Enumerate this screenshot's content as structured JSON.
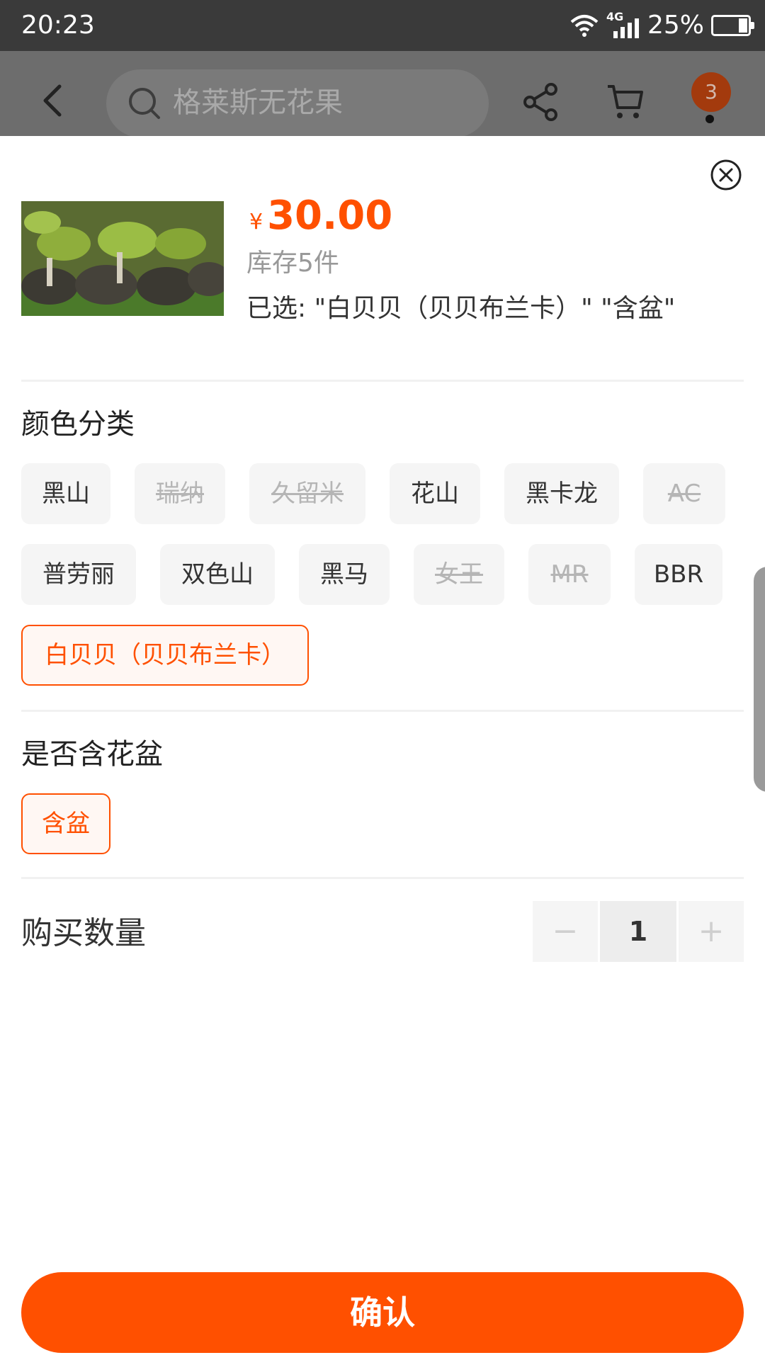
{
  "status_bar": {
    "time": "20:23",
    "network": "4G",
    "battery": "25%",
    "battery_level": 0.25
  },
  "header": {
    "back_icon": "chevron-left-icon",
    "search_placeholder": "格莱斯无花果",
    "share_icon": "share-icon",
    "cart_icon": "cart-icon",
    "badge_count": "3"
  },
  "product": {
    "currency": "¥",
    "price": "30.00",
    "stock": "库存5件",
    "selected": "已选: \"白贝贝（贝贝布兰卡）\" \"含盆\""
  },
  "color_section": {
    "title": "颜色分类",
    "options": [
      {
        "label": "黑山",
        "state": "normal"
      },
      {
        "label": "瑞纳",
        "state": "disabled"
      },
      {
        "label": "久留米",
        "state": "disabled"
      },
      {
        "label": "花山",
        "state": "normal"
      },
      {
        "label": "黑卡龙",
        "state": "normal"
      },
      {
        "label": "AC",
        "state": "disabled"
      },
      {
        "label": "普劳丽",
        "state": "normal"
      },
      {
        "label": "双色山",
        "state": "normal"
      },
      {
        "label": "黑马",
        "state": "normal"
      },
      {
        "label": "女王",
        "state": "disabled"
      },
      {
        "label": "MR",
        "state": "disabled"
      },
      {
        "label": "BBR",
        "state": "normal"
      },
      {
        "label": "白贝贝（贝贝布兰卡）",
        "state": "selected"
      }
    ]
  },
  "pot_section": {
    "title": "是否含花盆",
    "options": [
      {
        "label": "含盆",
        "state": "selected"
      }
    ]
  },
  "quantity": {
    "label": "购买数量",
    "minus": "−",
    "value": "1",
    "plus": "+"
  },
  "confirm_label": "确认",
  "colors": {
    "accent": "#ff5000",
    "chip_bg": "#f5f5f5",
    "disabled_text": "#b5b5b5"
  }
}
